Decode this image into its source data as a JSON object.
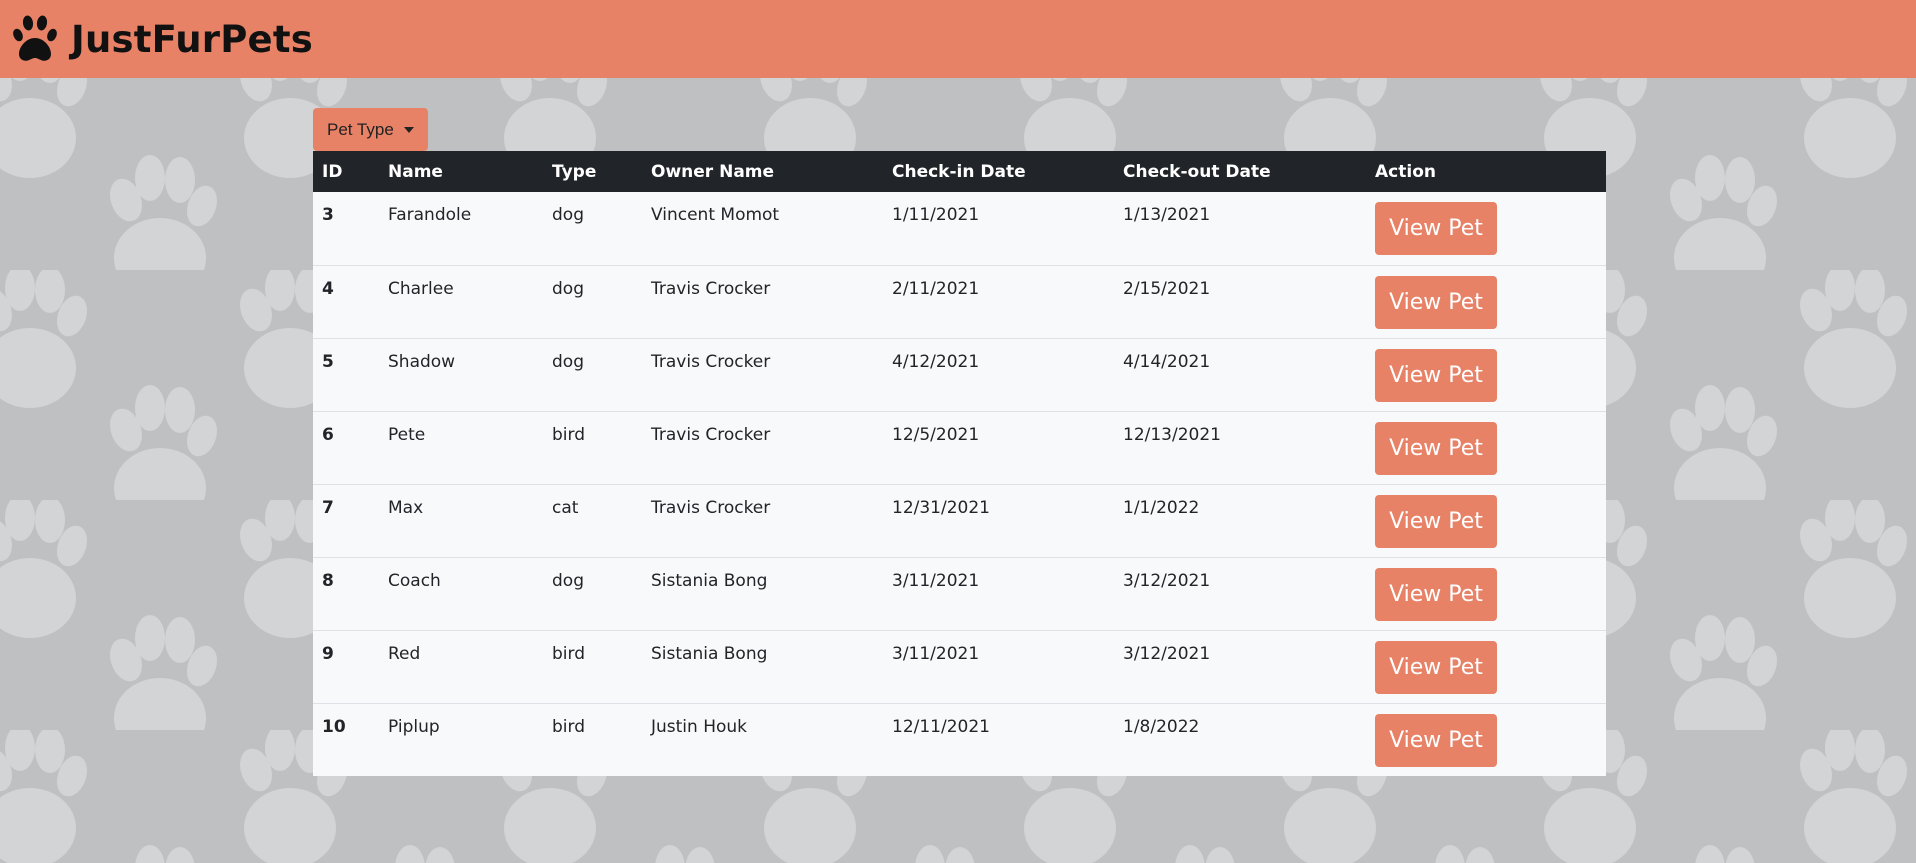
{
  "brand": {
    "name": "JustFurPets",
    "icon": "paw-icon",
    "color": "#e78267"
  },
  "filter": {
    "label": "Pet Type",
    "icon": "caret-down-icon"
  },
  "table": {
    "headers": [
      "ID",
      "Name",
      "Type",
      "Owner Name",
      "Check-in Date",
      "Check-out Date",
      "Action"
    ],
    "rows": [
      {
        "id": "3",
        "name": "Farandole",
        "type": "dog",
        "owner": "Vincent Momot",
        "checkin": "1/11/2021",
        "checkout": "1/13/2021",
        "action": "View Pet"
      },
      {
        "id": "4",
        "name": "Charlee",
        "type": "dog",
        "owner": "Travis Crocker",
        "checkin": "2/11/2021",
        "checkout": "2/15/2021",
        "action": "View Pet"
      },
      {
        "id": "5",
        "name": "Shadow",
        "type": "dog",
        "owner": "Travis Crocker",
        "checkin": "4/12/2021",
        "checkout": "4/14/2021",
        "action": "View Pet"
      },
      {
        "id": "6",
        "name": "Pete",
        "type": "bird",
        "owner": "Travis Crocker",
        "checkin": "12/5/2021",
        "checkout": "12/13/2021",
        "action": "View Pet"
      },
      {
        "id": "7",
        "name": "Max",
        "type": "cat",
        "owner": "Travis Crocker",
        "checkin": "12/31/2021",
        "checkout": "1/1/2022",
        "action": "View Pet"
      },
      {
        "id": "8",
        "name": "Coach",
        "type": "dog",
        "owner": "Sistania Bong",
        "checkin": "3/11/2021",
        "checkout": "3/12/2021",
        "action": "View Pet"
      },
      {
        "id": "9",
        "name": "Red",
        "type": "bird",
        "owner": "Sistania Bong",
        "checkin": "3/11/2021",
        "checkout": "3/12/2021",
        "action": "View Pet"
      },
      {
        "id": "10",
        "name": "Piplup",
        "type": "bird",
        "owner": "Justin Houk",
        "checkin": "12/11/2021",
        "checkout": "1/8/2022",
        "action": "View Pet"
      }
    ]
  }
}
